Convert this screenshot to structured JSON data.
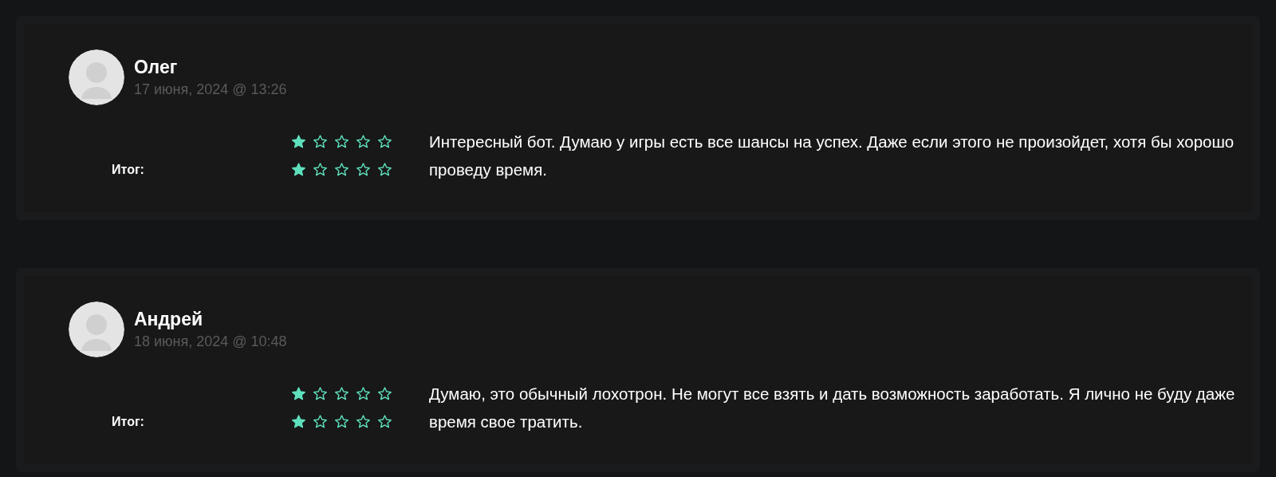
{
  "reviews": [
    {
      "name": "Олег",
      "date": "17 июня, 2024 @ 13:26",
      "ratings": [
        {
          "stars": 1
        },
        {
          "label": "Итог:",
          "stars": 1
        }
      ],
      "text": "Интересный бот. Думаю у игры есть все шансы на успех. Даже если этого не произойдет, хотя бы хорошо проведу время."
    },
    {
      "name": "Андрей",
      "date": "18 июня, 2024 @ 10:48",
      "ratings": [
        {
          "stars": 1
        },
        {
          "label": "Итог:",
          "stars": 1
        }
      ],
      "text": "Думаю, это обычный лохотрон. Не могут все взять и дать возможность заработать. Я лично не буду даже время свое тратить."
    }
  ]
}
